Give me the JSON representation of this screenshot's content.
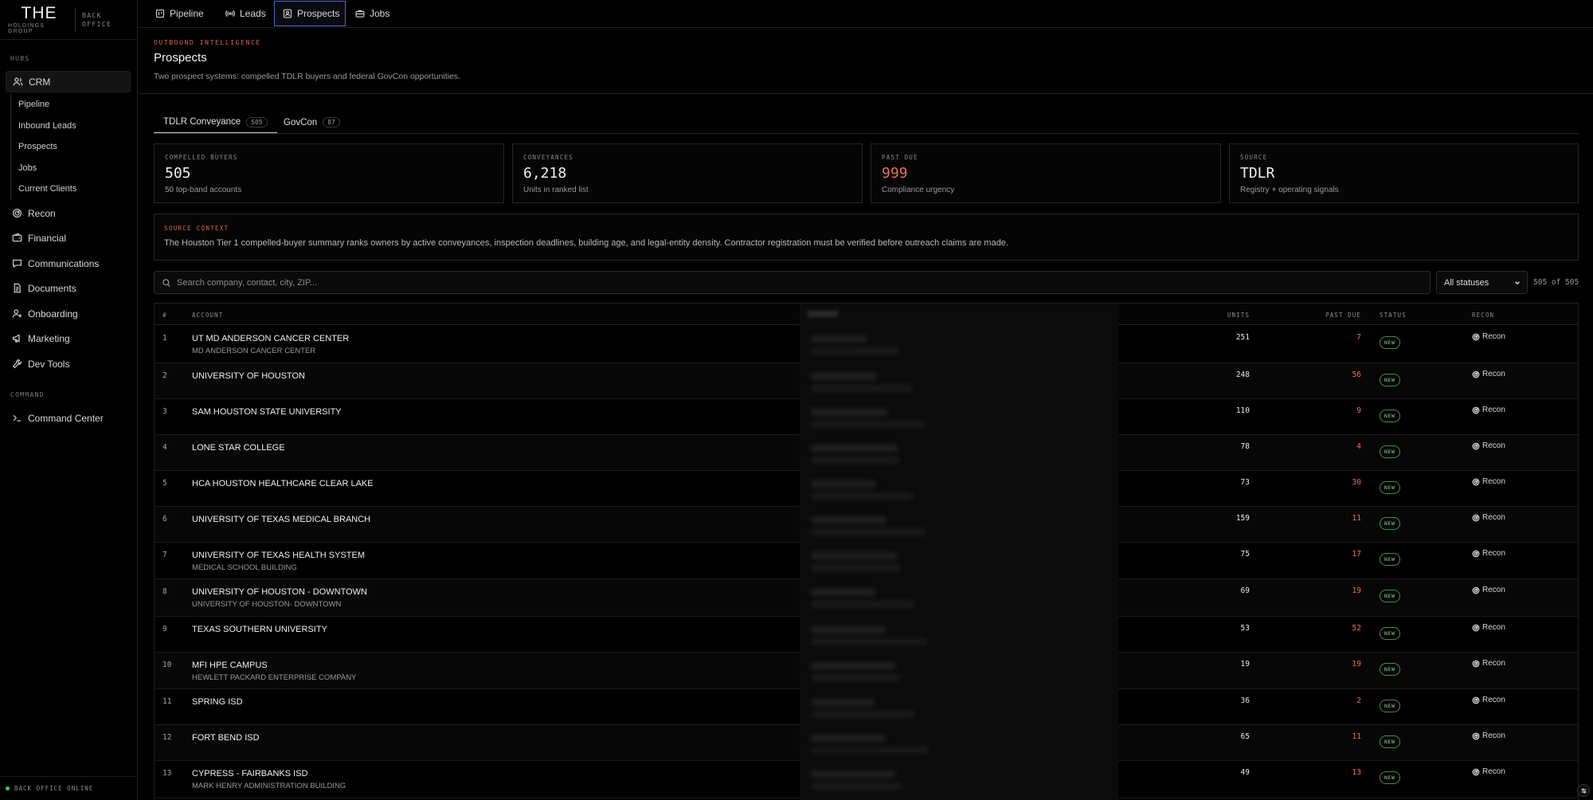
{
  "brand": {
    "logo": "THE",
    "logo_sub": "HOLDINGS GROUP",
    "back_office_1": "BACK",
    "back_office_2": "OFFICE"
  },
  "sidebar": {
    "hubs_label": "HUBS",
    "crm": "CRM",
    "crm_sub": [
      "Pipeline",
      "Inbound Leads",
      "Prospects",
      "Jobs",
      "Current Clients"
    ],
    "items": [
      {
        "label": "Recon",
        "icon": "recon-icon"
      },
      {
        "label": "Financial",
        "icon": "wallet-icon"
      },
      {
        "label": "Communications",
        "icon": "chat-icon"
      },
      {
        "label": "Documents",
        "icon": "document-icon"
      },
      {
        "label": "Onboarding",
        "icon": "user-plus-icon"
      },
      {
        "label": "Marketing",
        "icon": "megaphone-icon"
      },
      {
        "label": "Dev Tools",
        "icon": "wrench-icon"
      }
    ],
    "command_label": "COMMAND",
    "command_center": "Command Center",
    "status": "BACK OFFICE ONLINE"
  },
  "topnav": {
    "tabs": [
      "Pipeline",
      "Leads",
      "Prospects",
      "Jobs"
    ],
    "active": "Prospects"
  },
  "header": {
    "kicker": "OUTBOUND INTELLIGENCE",
    "title": "Prospects",
    "subtitle": "Two prospect systems: compelled TDLR buyers and federal GovCon opportunities."
  },
  "subtabs": [
    {
      "label": "TDLR Conveyance",
      "count": "505"
    },
    {
      "label": "GovCon",
      "count": "87"
    }
  ],
  "cards": [
    {
      "label": "COMPELLED BUYERS",
      "value": "505",
      "note": "50 top-band accounts"
    },
    {
      "label": "CONVEYANCES",
      "value": "6,218",
      "note": "Units in ranked list"
    },
    {
      "label": "PAST DUE",
      "value": "999",
      "note": "Compliance urgency"
    },
    {
      "label": "SOURCE",
      "value": "TDLR",
      "note": "Registry + operating signals"
    }
  ],
  "context": {
    "label": "SOURCE CONTEXT",
    "text": "The Houston Tier 1 compelled-buyer summary ranks owners by active conveyances, inspection deadlines, building age, and legal-entity density. Contractor registration must be verified before outreach claims are made."
  },
  "search": {
    "placeholder": "Search company, contact, city, ZIP..."
  },
  "filter": {
    "selected": "All statuses"
  },
  "count": "505 of 505",
  "table": {
    "headers": {
      "num": "#",
      "account": "ACCOUNT",
      "city": "CITY",
      "units": "UNITS",
      "past_due": "PAST DUE",
      "status": "STATUS",
      "recon": "RECON"
    },
    "recon_label": "Recon",
    "rows": [
      {
        "num": "1",
        "name": "UT MD ANDERSON CANCER CENTER",
        "sub": "MD ANDERSON CANCER CENTER",
        "city": "HOUSTON",
        "units": "251",
        "past_due": "7",
        "status": "NEW"
      },
      {
        "num": "2",
        "name": "UNIVERSITY OF HOUSTON",
        "sub": "",
        "city": "HOUSTON",
        "units": "248",
        "past_due": "56",
        "status": "NEW"
      },
      {
        "num": "3",
        "name": "SAM HOUSTON STATE UNIVERSITY",
        "sub": "",
        "city": "HUNTSVILLE",
        "units": "110",
        "past_due": "9",
        "status": "NEW"
      },
      {
        "num": "4",
        "name": "LONE STAR COLLEGE",
        "sub": "",
        "city": "HOUSTON",
        "units": "78",
        "past_due": "4",
        "status": "NEW"
      },
      {
        "num": "5",
        "name": "HCA HOUSTON HEALTHCARE CLEAR LAKE",
        "sub": "",
        "city": "WEBSTER",
        "units": "73",
        "past_due": "30",
        "status": "NEW"
      },
      {
        "num": "6",
        "name": "UNIVERSITY OF TEXAS MEDICAL BRANCH",
        "sub": "",
        "city": "GALVESTON",
        "units": "159",
        "past_due": "11",
        "status": "NEW"
      },
      {
        "num": "7",
        "name": "UNIVERSITY OF TEXAS HEALTH SYSTEM",
        "sub": "MEDICAL SCHOOL BUILDING",
        "city": "HOUSTON",
        "units": "75",
        "past_due": "17",
        "status": "NEW"
      },
      {
        "num": "8",
        "name": "UNIVERSITY OF HOUSTON - DOWNTOWN",
        "sub": "UNIVERSITY OF HOUSTON- DOWNTOWN",
        "city": "HOUSTON",
        "units": "69",
        "past_due": "19",
        "status": "NEW"
      },
      {
        "num": "9",
        "name": "TEXAS SOUTHERN UNIVERSITY",
        "sub": "",
        "city": "HOUSTON",
        "units": "53",
        "past_due": "52",
        "status": "NEW"
      },
      {
        "num": "10",
        "name": "MFI HPE CAMPUS",
        "sub": "HEWLETT PACKARD ENTERPRISE COMPANY",
        "city": "HOUSTON",
        "units": "19",
        "past_due": "19",
        "status": "NEW"
      },
      {
        "num": "11",
        "name": "SPRING ISD",
        "sub": "",
        "city": "HOUSTON",
        "units": "36",
        "past_due": "2",
        "status": "NEW"
      },
      {
        "num": "12",
        "name": "FORT BEND ISD",
        "sub": "",
        "city": "SUGAR LAND",
        "units": "65",
        "past_due": "11",
        "status": "NEW"
      },
      {
        "num": "13",
        "name": "CYPRESS - FAIRBANKS ISD",
        "sub": "MARK HENRY ADMINISTRATION BUILDING",
        "city": "CYPRESS",
        "units": "49",
        "past_due": "13",
        "status": "NEW"
      }
    ]
  },
  "colors": {
    "accent": "#5567c8",
    "alert": "#e8735c",
    "kicker": "#d7664f",
    "status_ok": "#3fcf5e"
  }
}
